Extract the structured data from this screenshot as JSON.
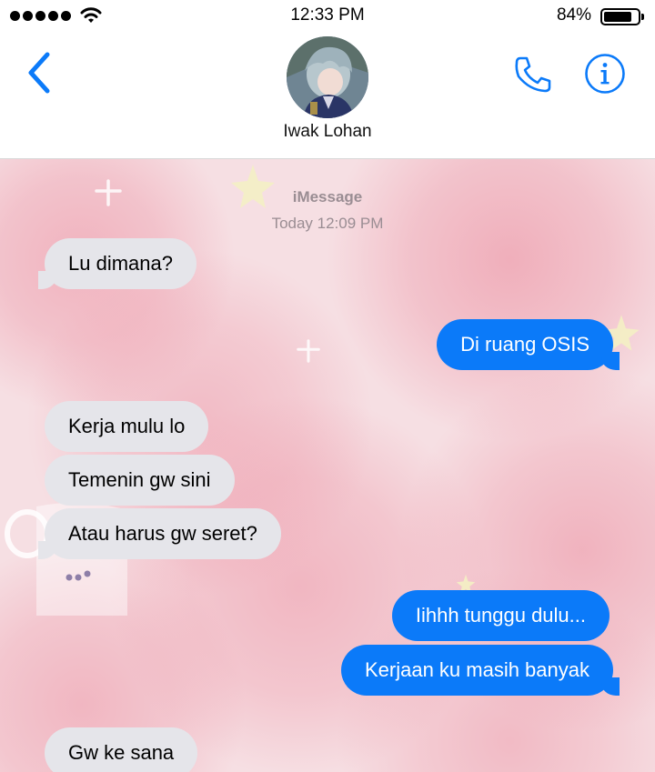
{
  "status_bar": {
    "time": "12:33 PM",
    "battery_percent_label": "84%",
    "battery_level": 0.84,
    "signal_bars": 5
  },
  "header": {
    "back_icon": "chevron-left-icon",
    "contact_name": "Iwak Lohan",
    "call_icon": "phone-icon",
    "info_icon": "info-icon",
    "accent_color": "#0b7af9"
  },
  "chat": {
    "service": "iMessage",
    "timestamp": "Today 12:09 PM",
    "messages": [
      {
        "direction": "received",
        "text": "Lu dimana?"
      },
      {
        "direction": "sent",
        "text": "Di ruang OSIS"
      },
      {
        "direction": "received",
        "text": "Kerja mulu lo"
      },
      {
        "direction": "received",
        "text": "Temenin gw sini"
      },
      {
        "direction": "received",
        "text": "Atau harus gw seret?"
      },
      {
        "direction": "sent",
        "text": "Iihhh tunggu dulu..."
      },
      {
        "direction": "sent",
        "text": "Kerjaan ku masih banyak"
      },
      {
        "direction": "received",
        "text": "Gw ke sana"
      }
    ],
    "colors": {
      "sent_bubble": "#0b7af9",
      "received_bubble": "#e5e5ea",
      "wallpaper": "#f6dfe3"
    }
  }
}
